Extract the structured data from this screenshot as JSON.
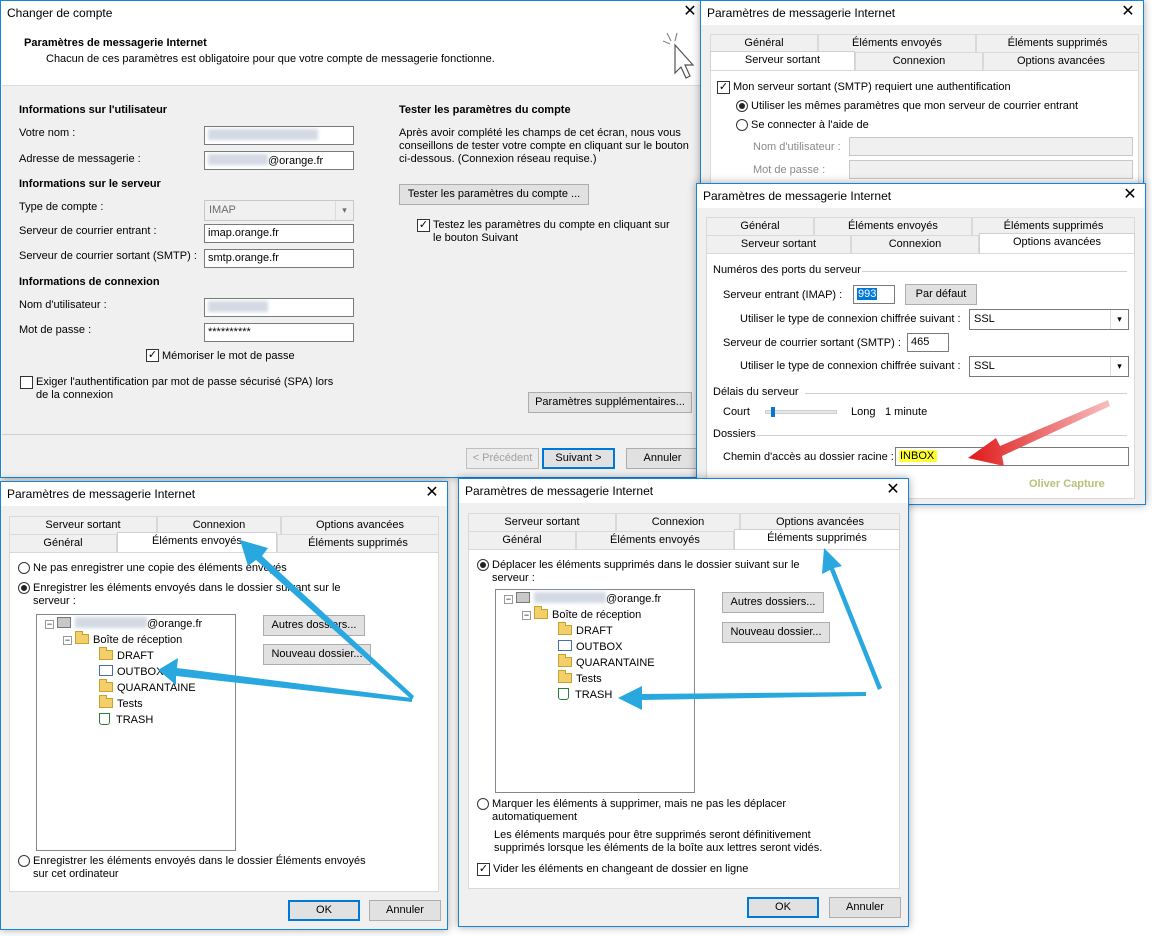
{
  "w1": {
    "title": "Changer de compte",
    "heading": "Paramètres de messagerie Internet",
    "subheading": "Chacun de ces paramètres est obligatoire pour que votre compte de messagerie fonctionne.",
    "user_info_title": "Informations sur l'utilisateur",
    "name_label": "Votre nom :",
    "email_label": "Adresse de messagerie :",
    "email_value": "@orange.fr",
    "server_info_title": "Informations sur le serveur",
    "account_type_label": "Type de compte :",
    "account_type_value": "IMAP",
    "incoming_label": "Serveur de courrier entrant :",
    "incoming_value": "imap.orange.fr",
    "outgoing_label": "Serveur de courrier sortant (SMTP) :",
    "outgoing_value": "smtp.orange.fr",
    "login_info_title": "Informations de connexion",
    "username_label": "Nom d'utilisateur :",
    "password_label": "Mot de passe :",
    "password_value": "**********",
    "remember_label": "Mémoriser le mot de passe",
    "spa_label": "Exiger l'authentification par mot de passe sécurisé (SPA) lors",
    "spa_label2": "de la connexion",
    "test_title": "Tester les paramètres du compte",
    "test_desc1": "Après avoir complété les champs de cet écran, nous vous",
    "test_desc2": "conseillons de tester votre compte en cliquant sur le bouton",
    "test_desc3": "ci-dessous. (Connexion réseau requise.)",
    "test_button": "Tester les paramètres du compte ...",
    "test_next_label1": "Testez les paramètres du compte en cliquant sur",
    "test_next_label2": "le bouton Suivant",
    "more_settings_button": "Paramètres supplémentaires...",
    "prev_button": "< Précédent",
    "next_button": "Suivant >",
    "cancel_button": "Annuler"
  },
  "w2": {
    "title": "Paramètres de messagerie Internet",
    "tabs_row1": [
      "Général",
      "Éléments envoyés",
      "Éléments supprimés"
    ],
    "tabs_row2": [
      "Serveur sortant",
      "Connexion",
      "Options avancées"
    ],
    "smtp_auth_label": "Mon serveur sortant (SMTP) requiert une authentification",
    "same_settings_label": "Utiliser les mêmes paramètres que mon serveur de courrier entrant",
    "connect_with_label": "Se connecter à l'aide de",
    "username_label": "Nom d'utilisateur :",
    "password_label": "Mot de passe :"
  },
  "w3": {
    "title": "Paramètres de messagerie Internet",
    "tabs_row1": [
      "Général",
      "Éléments envoyés",
      "Éléments supprimés"
    ],
    "tabs_row2": [
      "Serveur sortant",
      "Connexion",
      "Options avancées"
    ],
    "ports_title": "Numéros des ports du serveur",
    "imap_label": "Serveur entrant (IMAP) :",
    "imap_value": "993",
    "default_button": "Par défaut",
    "enc_label": "Utiliser le type de connexion chiffrée suivant :",
    "enc_in_value": "SSL",
    "smtp_label": "Serveur de courrier sortant (SMTP) :",
    "smtp_value": "465",
    "enc_out_value": "SSL",
    "timeout_title": "Délais du serveur",
    "short_label": "Court",
    "long_label": "Long",
    "timeout_value": "1 minute",
    "folders_title": "Dossiers",
    "root_label": "Chemin d'accès au dossier racine :",
    "root_value": "INBOX",
    "watermark": "Oliver Capture"
  },
  "w4": {
    "title": "Paramètres de messagerie Internet",
    "tabs_row1": [
      "Serveur sortant",
      "Connexion",
      "Options avancées"
    ],
    "tabs_row2": [
      "Général",
      "Éléments envoyés",
      "Éléments supprimés"
    ],
    "opt_no_copy": "Ne pas enregistrer une copie des éléments envoyés",
    "opt_server_1": "Enregistrer les éléments envoyés dans le dossier suivant sur le",
    "opt_server_2": "serveur :",
    "account": "@orange.fr",
    "inbox": "Boîte de réception",
    "folders": [
      "DRAFT",
      "OUTBOX",
      "QUARANTAINE",
      "Tests",
      "TRASH"
    ],
    "other_folders_button": "Autres dossiers...",
    "new_folder_button": "Nouveau dossier...",
    "opt_local_1": "Enregistrer les éléments envoyés dans le dossier Éléments envoyés",
    "opt_local_2": "sur cet ordinateur",
    "ok_button": "OK",
    "cancel_button": "Annuler"
  },
  "w5": {
    "title": "Paramètres de messagerie Internet",
    "tabs_row1": [
      "Serveur sortant",
      "Connexion",
      "Options avancées"
    ],
    "tabs_row2": [
      "Général",
      "Éléments envoyés",
      "Éléments supprimés"
    ],
    "opt_move_1": "Déplacer les éléments supprimés dans le dossier suivant sur le",
    "opt_move_2": "serveur :",
    "account": "@orange.fr",
    "inbox": "Boîte de réception",
    "folders": [
      "DRAFT",
      "OUTBOX",
      "QUARANTAINE",
      "Tests",
      "TRASH"
    ],
    "other_folders_button": "Autres dossiers...",
    "new_folder_button": "Nouveau dossier...",
    "opt_mark_1": "Marquer les éléments à supprimer, mais ne pas les déplacer",
    "opt_mark_2": "automatiquement",
    "info_1": "Les éléments marqués pour être supprimés seront définitivement",
    "info_2": "supprimés lorsque les éléments de la boîte aux lettres seront vidés.",
    "purge_label": "Vider les éléments en changeant de dossier en ligne",
    "ok_button": "OK",
    "cancel_button": "Annuler"
  },
  "colors": {
    "window_border": "#1883d7",
    "annotation_blue": "#29a8e0",
    "annotation_red": "#e01818",
    "highlight_yellow": "#ffff33",
    "selection_blue": "#0078d7"
  }
}
